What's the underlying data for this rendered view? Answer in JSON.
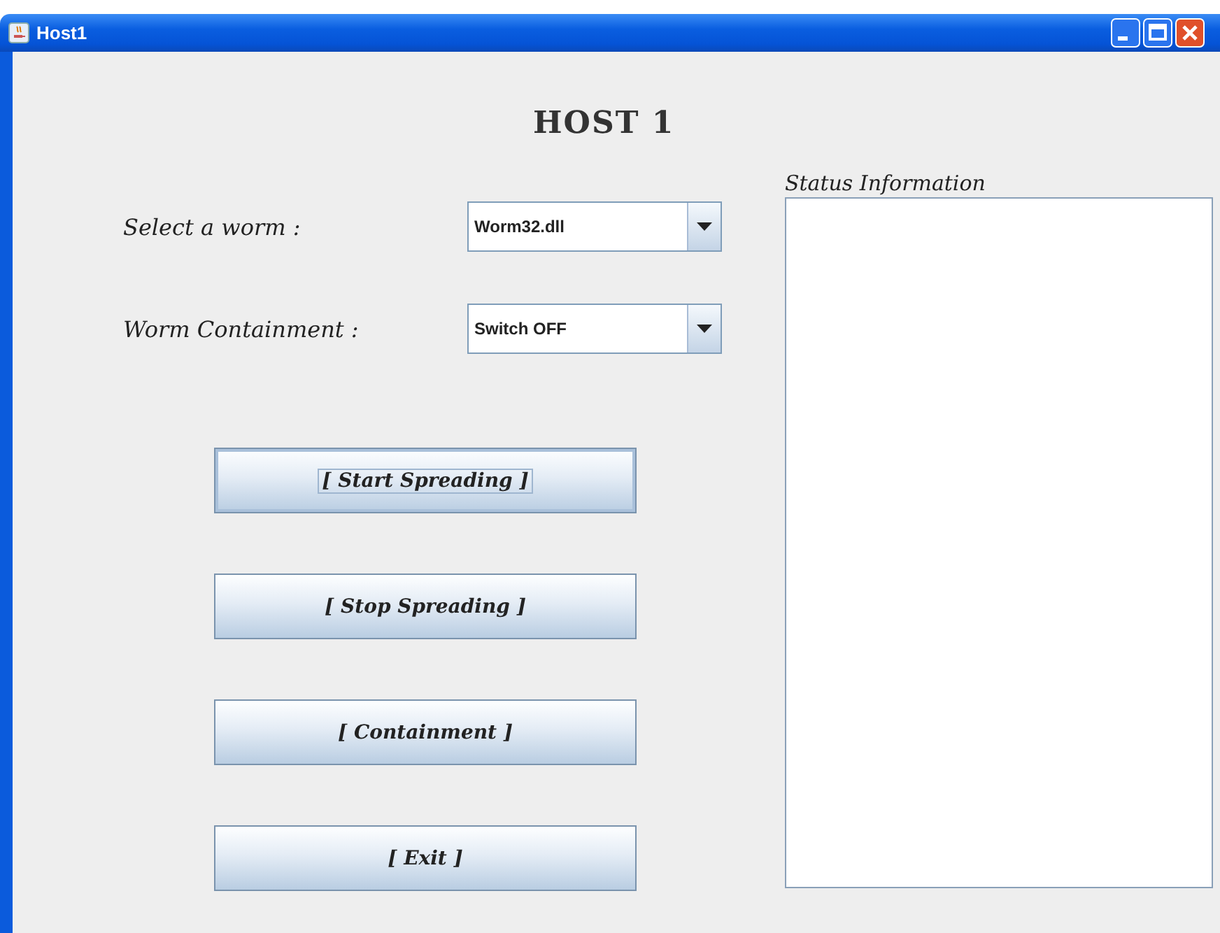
{
  "window": {
    "title": "Host1"
  },
  "heading": "HOST 1",
  "form": [
    {
      "label": "Select a worm :",
      "value": "Worm32.dll"
    },
    {
      "label": "Worm Containment :",
      "value": "Switch OFF"
    }
  ],
  "buttons": [
    {
      "label": "[ Start Spreading ]",
      "focused": true
    },
    {
      "label": "[ Stop Spreading ]",
      "focused": false
    },
    {
      "label": "[ Containment ]",
      "focused": false
    },
    {
      "label": "[ Exit ]",
      "focused": false
    }
  ],
  "status": {
    "label": "Status Information"
  }
}
